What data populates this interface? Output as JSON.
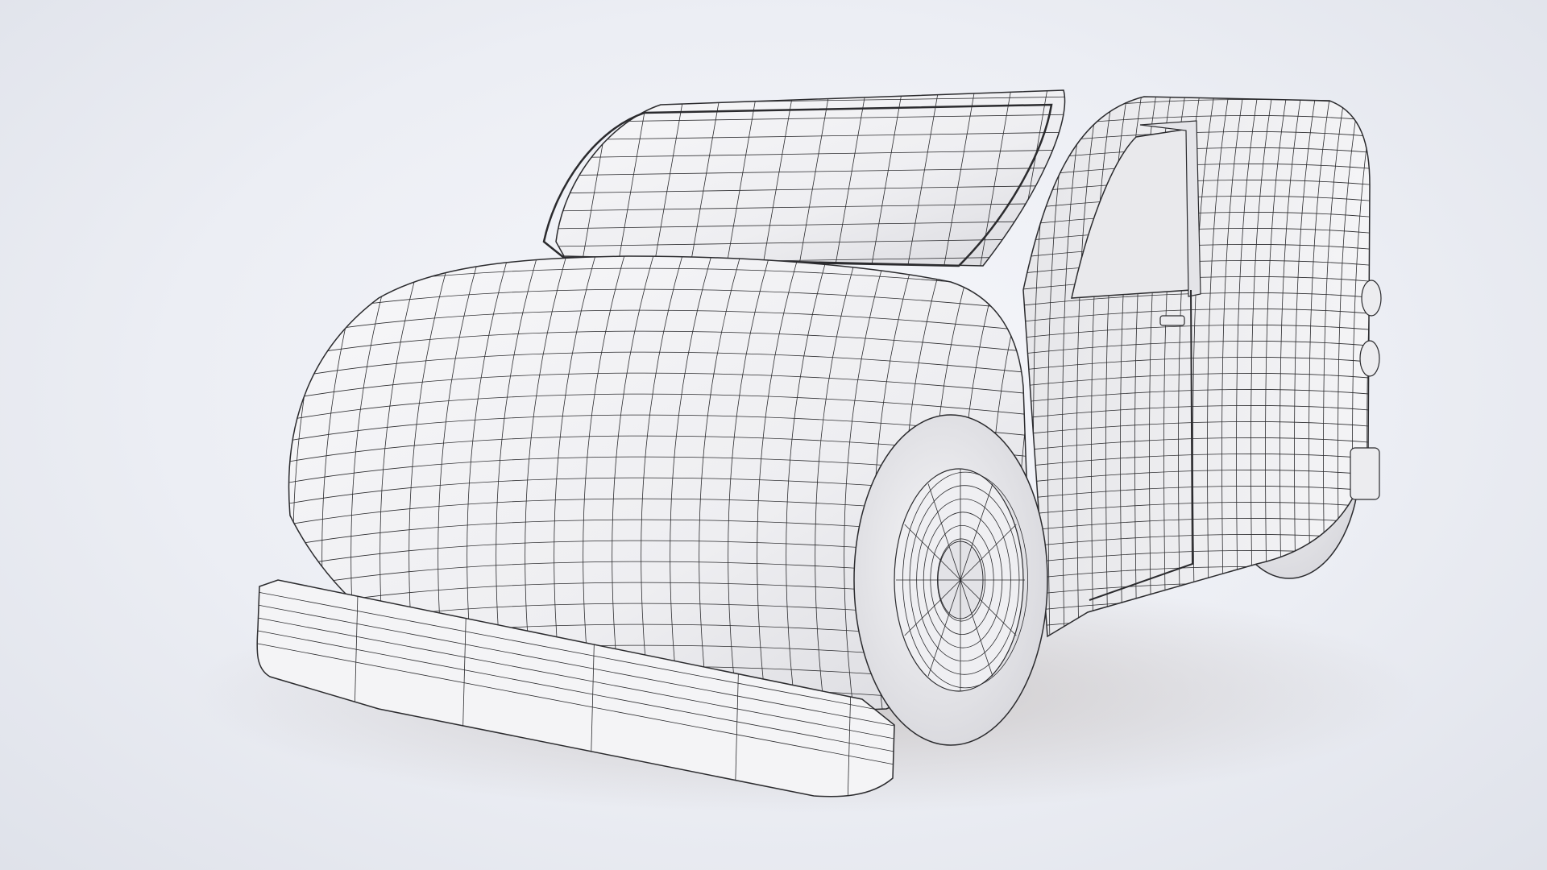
{
  "scene": {
    "subject": "wireframe-van-render",
    "colors": {
      "background_center": "#f6f7fb",
      "background_edge": "#dfe2ea",
      "body_fill": "#f3f3f5",
      "body_shade": "#dcdde2",
      "wire": "#2b2b2e",
      "shadow": "#c9c6c6"
    },
    "icons": []
  }
}
